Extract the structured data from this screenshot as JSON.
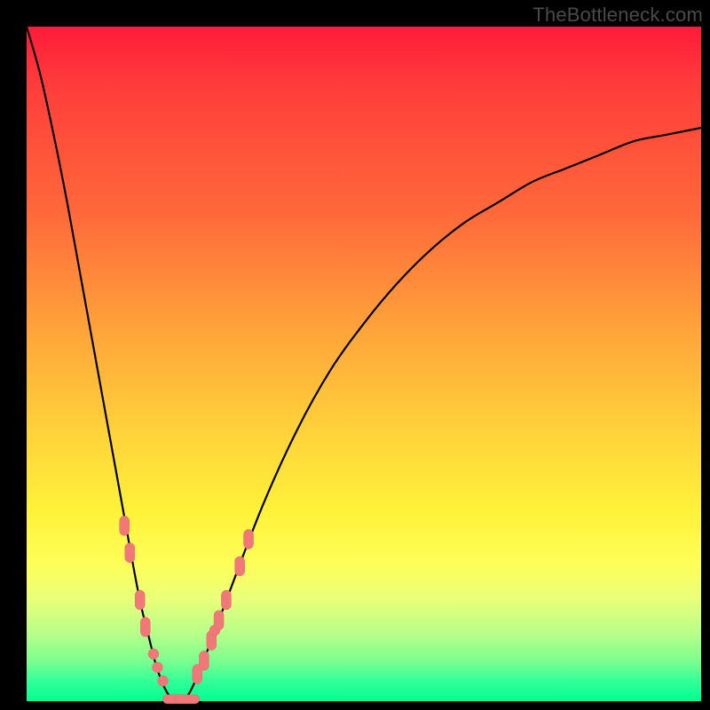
{
  "watermark": "TheBottleneck.com",
  "colors": {
    "frame": "#000000",
    "gradient_top": "#ff1a3a",
    "gradient_bottom": "#00ff90",
    "curve": "#000000",
    "markers": "#f07878"
  },
  "chart_data": {
    "type": "line",
    "title": "",
    "xlabel": "",
    "ylabel": "",
    "xlim": [
      0,
      100
    ],
    "ylim": [
      0,
      100
    ],
    "grid": false,
    "annotations": [
      "TheBottleneck.com"
    ],
    "series": [
      {
        "name": "bottleneck-curve",
        "x": [
          0,
          2,
          4,
          6,
          8,
          10,
          12,
          14,
          16,
          17,
          18,
          19,
          20,
          21,
          22,
          23,
          24,
          25,
          27,
          30,
          35,
          40,
          45,
          50,
          55,
          60,
          65,
          70,
          75,
          80,
          85,
          90,
          95,
          100
        ],
        "y": [
          100,
          93,
          84,
          74,
          63,
          52,
          41,
          30,
          19,
          14,
          10,
          6,
          3,
          1,
          0,
          0,
          1,
          3,
          8,
          16,
          29,
          40,
          49,
          56,
          62,
          67,
          71,
          74,
          77,
          79,
          81,
          83,
          84,
          85
        ]
      }
    ],
    "markers": [
      {
        "x": 14.5,
        "y": 26,
        "shape": "rect"
      },
      {
        "x": 15.3,
        "y": 22,
        "shape": "rect"
      },
      {
        "x": 16.8,
        "y": 15,
        "shape": "rect"
      },
      {
        "x": 17.6,
        "y": 11,
        "shape": "rect"
      },
      {
        "x": 18.8,
        "y": 7,
        "shape": "circle"
      },
      {
        "x": 19.4,
        "y": 5,
        "shape": "circle"
      },
      {
        "x": 20.2,
        "y": 3,
        "shape": "circle"
      },
      {
        "x": 22.0,
        "y": 0.3,
        "shape": "rect-wide"
      },
      {
        "x": 23.8,
        "y": 0.3,
        "shape": "rect-wide"
      },
      {
        "x": 25.3,
        "y": 4,
        "shape": "rect"
      },
      {
        "x": 26.3,
        "y": 6,
        "shape": "rect"
      },
      {
        "x": 27.4,
        "y": 9,
        "shape": "rect"
      },
      {
        "x": 27.9,
        "y": 10.5,
        "shape": "circle"
      },
      {
        "x": 28.5,
        "y": 12,
        "shape": "rect"
      },
      {
        "x": 29.6,
        "y": 15,
        "shape": "rect"
      },
      {
        "x": 31.6,
        "y": 20,
        "shape": "rect"
      },
      {
        "x": 32.9,
        "y": 24,
        "shape": "rect"
      }
    ]
  }
}
